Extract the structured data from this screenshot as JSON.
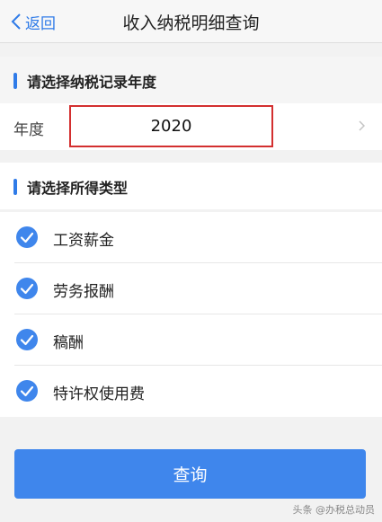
{
  "navbar": {
    "back_label": "返回",
    "title": "收入纳税明细查询"
  },
  "year_section": {
    "header": "请选择纳税记录年度",
    "row_label": "年度",
    "selected_year": "2020"
  },
  "income_section": {
    "header": "请选择所得类型",
    "items": [
      {
        "label": "工资薪金",
        "checked": true
      },
      {
        "label": "劳务报酬",
        "checked": true
      },
      {
        "label": "稿酬",
        "checked": true
      },
      {
        "label": "特许权使用费",
        "checked": true
      }
    ]
  },
  "query_button": {
    "label": "查询"
  },
  "watermark": {
    "text": "头条 @办税总动员"
  },
  "colors": {
    "accent": "#2f7be8",
    "button": "#3f86ec",
    "highlight_border": "#d32f2f"
  }
}
